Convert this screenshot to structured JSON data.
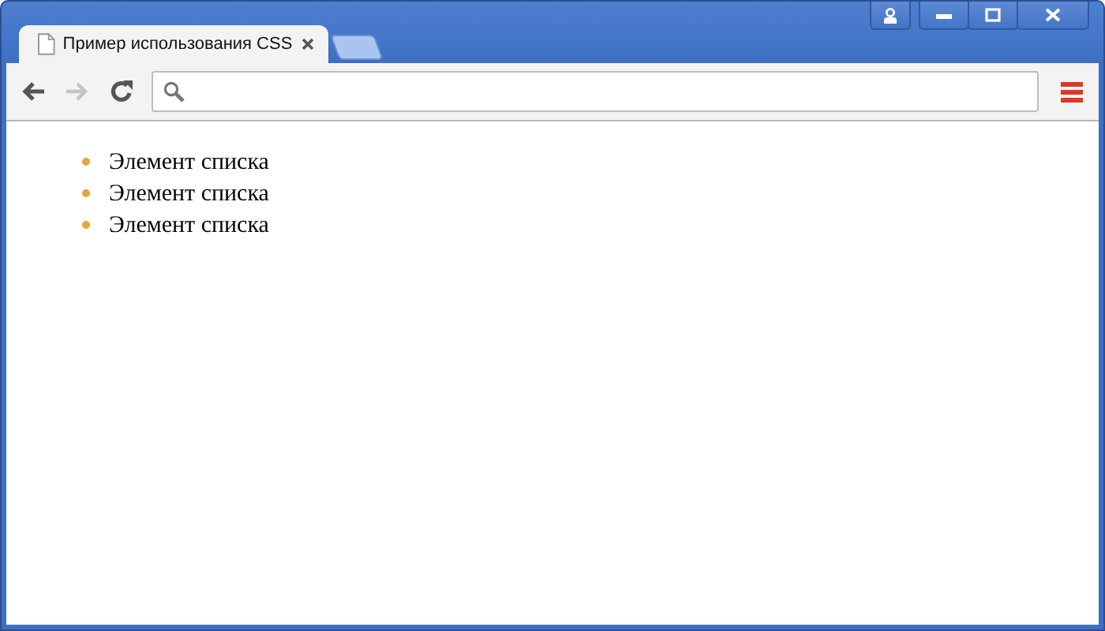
{
  "tabs": [
    {
      "title": "Пример использования CSS",
      "selected": true
    }
  ],
  "list_items": [
    "Элемент списка",
    "Элемент списка",
    "Элемент списка"
  ]
}
